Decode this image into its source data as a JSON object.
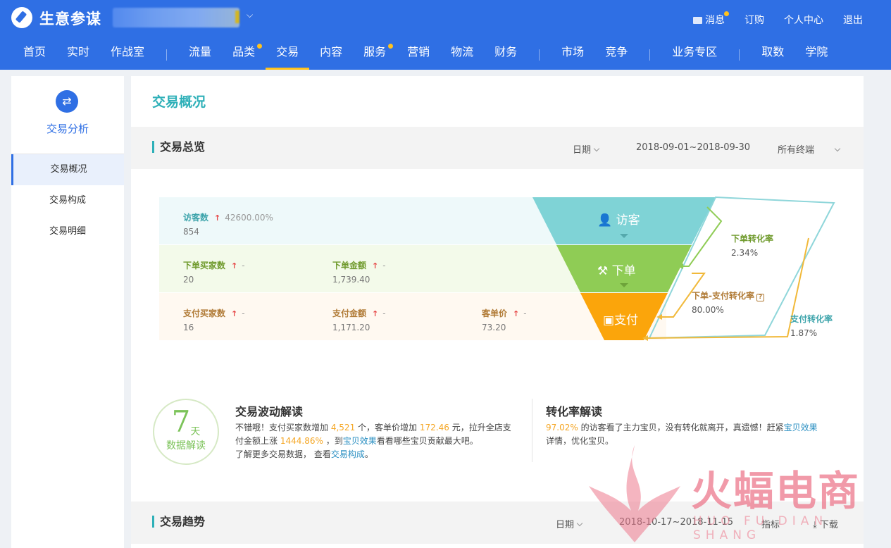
{
  "app": {
    "title": "生意参谋"
  },
  "top_links": [
    {
      "label": "消息",
      "has_dot": true
    },
    {
      "label": "订购"
    },
    {
      "label": "个人中心"
    },
    {
      "label": "退出"
    }
  ],
  "nav": {
    "items": [
      "首页",
      "实时",
      "作战室",
      "流量",
      "品类",
      "交易",
      "内容",
      "服务",
      "营销",
      "物流",
      "财务",
      "市场",
      "竞争",
      "业务专区",
      "取数",
      "学院"
    ],
    "active": "交易",
    "dots": [
      "品类",
      "服务"
    ]
  },
  "sidebar": {
    "section_title": "交易分析",
    "items": [
      "交易概况",
      "交易构成",
      "交易明细"
    ],
    "active": "交易概况"
  },
  "main": {
    "page_title": "交易概况",
    "overview": {
      "title": "交易总览",
      "date_label": "日期",
      "date_range": "2018-09-01~2018-09-30",
      "terminal": "所有终端",
      "visitors": {
        "label": "访客数",
        "change": "42600.00%",
        "value": "854"
      },
      "order_buyers": {
        "label": "下单买家数",
        "change": "-",
        "value": "20"
      },
      "order_amount": {
        "label": "下单金额",
        "change": "-",
        "value": "1,739.40"
      },
      "pay_buyers": {
        "label": "支付买家数",
        "change": "-",
        "value": "16"
      },
      "pay_amount": {
        "label": "支付金额",
        "change": "-",
        "value": "1,171.20"
      },
      "unit_price": {
        "label": "客单价",
        "change": "-",
        "value": "73.20"
      },
      "funnel": {
        "stage1": "访客",
        "stage2": "下单",
        "stage3": "支付",
        "colors": {
          "visit": "#7fd3d6",
          "order": "#8fcc55",
          "pay": "#fba50b"
        }
      },
      "conversions": {
        "order_rate": {
          "label": "下单转化率",
          "value": "2.34%"
        },
        "order_pay_rate": {
          "label": "下单-支付转化率",
          "value": "80.00%"
        },
        "pay_rate": {
          "label": "支付转化率",
          "value": "1.87%"
        }
      }
    },
    "insights": {
      "badge_num": "7",
      "badge_unit": "天",
      "badge_label": "数据解读",
      "wave": {
        "title": "交易波动解读",
        "p1": "不错哦！支付买家数增加",
        "v1": "4,521",
        "p2": "个，客单价增加",
        "v2": "172.46",
        "p3": "元，拉升全店支付金额上涨",
        "v3": "1444.86%",
        "p4": "，到",
        "link1": "宝贝效果",
        "p5": "看看哪些宝贝贡献最大吧。",
        "p6": "了解更多交易数据，  查看",
        "link2": "交易构成",
        "p7": "。"
      },
      "rate": {
        "title": "转化率解读",
        "v1": "97.02%",
        "p1": "的访客看了主力宝贝，没有转化就离开，真遗憾！赶紧",
        "link1": "宝贝效果",
        "p2": "详情，优化宝贝。"
      }
    },
    "trend": {
      "title": "交易趋势",
      "date_label": "日期",
      "date_range": "2018-10-17~2018-11-15",
      "metric_label": "指标",
      "download": "下载"
    }
  },
  "watermark": {
    "text": "火蝠电商",
    "sub": "HUO FU DIAN SHANG"
  }
}
